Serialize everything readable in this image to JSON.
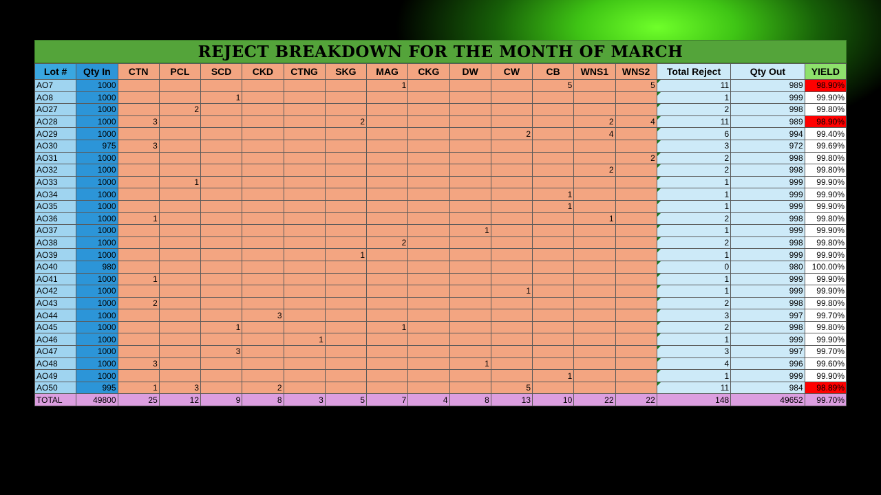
{
  "title": "REJECT BREAKDOWN FOR THE MONTH OF MARCH",
  "headers": [
    "Lot #",
    "Qty In",
    "CTN",
    "PCL",
    "SCD",
    "CKD",
    "CTNG",
    "SKG",
    "MAG",
    "CKG",
    "DW",
    "CW",
    "CB",
    "WNS1",
    "WNS2",
    "Total Reject",
    "Qty Out",
    "YIELD"
  ],
  "rows": [
    [
      "AO7",
      "1000",
      "",
      "",
      "",
      "",
      "",
      "",
      "1",
      "",
      "",
      "",
      "5",
      "",
      "5",
      "11",
      "989",
      "98.90%"
    ],
    [
      "AO8",
      "1000",
      "",
      "",
      "1",
      "",
      "",
      "",
      "",
      "",
      "",
      "",
      "",
      "",
      "",
      "1",
      "999",
      "99.90%"
    ],
    [
      "AO27",
      "1000",
      "",
      "2",
      "",
      "",
      "",
      "",
      "",
      "",
      "",
      "",
      "",
      "",
      "",
      "2",
      "998",
      "99.80%"
    ],
    [
      "AO28",
      "1000",
      "3",
      "",
      "",
      "",
      "",
      "2",
      "",
      "",
      "",
      "",
      "",
      "2",
      "4",
      "11",
      "989",
      "98.90%"
    ],
    [
      "AO29",
      "1000",
      "",
      "",
      "",
      "",
      "",
      "",
      "",
      "",
      "",
      "2",
      "",
      "4",
      "",
      "6",
      "994",
      "99.40%"
    ],
    [
      "AO30",
      "975",
      "3",
      "",
      "",
      "",
      "",
      "",
      "",
      "",
      "",
      "",
      "",
      "",
      "",
      "3",
      "972",
      "99.69%"
    ],
    [
      "AO31",
      "1000",
      "",
      "",
      "",
      "",
      "",
      "",
      "",
      "",
      "",
      "",
      "",
      "",
      "2",
      "2",
      "998",
      "99.80%"
    ],
    [
      "AO32",
      "1000",
      "",
      "",
      "",
      "",
      "",
      "",
      "",
      "",
      "",
      "",
      "",
      "2",
      "",
      "2",
      "998",
      "99.80%"
    ],
    [
      "AO33",
      "1000",
      "",
      "1",
      "",
      "",
      "",
      "",
      "",
      "",
      "",
      "",
      "",
      "",
      "",
      "1",
      "999",
      "99.90%"
    ],
    [
      "AO34",
      "1000",
      "",
      "",
      "",
      "",
      "",
      "",
      "",
      "",
      "",
      "",
      "1",
      "",
      "",
      "1",
      "999",
      "99.90%"
    ],
    [
      "AO35",
      "1000",
      "",
      "",
      "",
      "",
      "",
      "",
      "",
      "",
      "",
      "",
      "1",
      "",
      "",
      "1",
      "999",
      "99.90%"
    ],
    [
      "AO36",
      "1000",
      "1",
      "",
      "",
      "",
      "",
      "",
      "",
      "",
      "",
      "",
      "",
      "1",
      "",
      "2",
      "998",
      "99.80%"
    ],
    [
      "AO37",
      "1000",
      "",
      "",
      "",
      "",
      "",
      "",
      "",
      "",
      "1",
      "",
      "",
      "",
      "",
      "1",
      "999",
      "99.90%"
    ],
    [
      "AO38",
      "1000",
      "",
      "",
      "",
      "",
      "",
      "",
      "2",
      "",
      "",
      "",
      "",
      "",
      "",
      "2",
      "998",
      "99.80%"
    ],
    [
      "AO39",
      "1000",
      "",
      "",
      "",
      "",
      "",
      "1",
      "",
      "",
      "",
      "",
      "",
      "",
      "",
      "1",
      "999",
      "99.90%"
    ],
    [
      "AO40",
      "980",
      "",
      "",
      "",
      "",
      "",
      "",
      "",
      "",
      "",
      "",
      "",
      "",
      "",
      "0",
      "980",
      "100.00%"
    ],
    [
      "AO41",
      "1000",
      "1",
      "",
      "",
      "",
      "",
      "",
      "",
      "",
      "",
      "",
      "",
      "",
      "",
      "1",
      "999",
      "99.90%"
    ],
    [
      "AO42",
      "1000",
      "",
      "",
      "",
      "",
      "",
      "",
      "",
      "",
      "",
      "1",
      "",
      "",
      "",
      "1",
      "999",
      "99.90%"
    ],
    [
      "AO43",
      "1000",
      "2",
      "",
      "",
      "",
      "",
      "",
      "",
      "",
      "",
      "",
      "",
      "",
      "",
      "2",
      "998",
      "99.80%"
    ],
    [
      "AO44",
      "1000",
      "",
      "",
      "",
      "3",
      "",
      "",
      "",
      "",
      "",
      "",
      "",
      "",
      "",
      "3",
      "997",
      "99.70%"
    ],
    [
      "AO45",
      "1000",
      "",
      "",
      "1",
      "",
      "",
      "",
      "1",
      "",
      "",
      "",
      "",
      "",
      "",
      "2",
      "998",
      "99.80%"
    ],
    [
      "AO46",
      "1000",
      "",
      "",
      "",
      "",
      "1",
      "",
      "",
      "",
      "",
      "",
      "",
      "",
      "",
      "1",
      "999",
      "99.90%"
    ],
    [
      "AO47",
      "1000",
      "",
      "",
      "3",
      "",
      "",
      "",
      "",
      "",
      "",
      "",
      "",
      "",
      "",
      "3",
      "997",
      "99.70%"
    ],
    [
      "AO48",
      "1000",
      "3",
      "",
      "",
      "",
      "",
      "",
      "",
      "",
      "1",
      "",
      "",
      "",
      "",
      "4",
      "996",
      "99.60%"
    ],
    [
      "AO49",
      "1000",
      "",
      "",
      "",
      "",
      "",
      "",
      "",
      "",
      "",
      "",
      "1",
      "",
      "",
      "1",
      "999",
      "99.90%"
    ],
    [
      "AO50",
      "995",
      "1",
      "3",
      "",
      "2",
      "",
      "",
      "",
      "",
      "",
      "5",
      "",
      "",
      "",
      "11",
      "984",
      "98.89%"
    ]
  ],
  "low_yield_rows": [
    "AO7",
    "AO28",
    "AO50"
  ],
  "total_row": [
    "TOTAL",
    "49800",
    "25",
    "12",
    "9",
    "8",
    "3",
    "5",
    "7",
    "4",
    "8",
    "13",
    "10",
    "22",
    "22",
    "148",
    "49652",
    "99.70%"
  ],
  "colors": {
    "title_bar": "#54a43a",
    "header_blue": "#3aa7e0",
    "reject_cells": "#f3a581",
    "total_reject_cells": "#cdeaf8",
    "yield_header": "#8ee06c",
    "low_yield": "#ff0000",
    "total_row": "#dc9ee0"
  }
}
